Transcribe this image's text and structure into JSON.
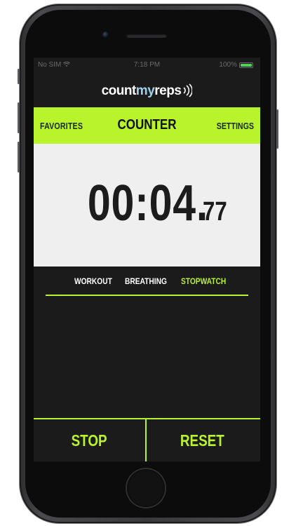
{
  "status_bar": {
    "carrier": "No SIM",
    "wifi_icon": "wifi-icon",
    "time": "7:18 PM",
    "battery_percent": "100%",
    "battery_level": 1.0,
    "battery_color": "#4bd15c"
  },
  "logo": {
    "part1": "count",
    "part2": "my",
    "part3": "reps",
    "icon": "sound-waves-icon"
  },
  "nav": {
    "left": "FAVORITES",
    "title": "COUNTER",
    "right": "SETTINGS"
  },
  "timer": {
    "main": "00:04.",
    "fraction": "77"
  },
  "modes": {
    "items": [
      "WORKOUT",
      "BREATHING",
      "STOPWATCH"
    ],
    "active": "STOPWATCH"
  },
  "controls": {
    "stop_label": "STOP",
    "reset_label": "RESET"
  },
  "colors": {
    "accent": "#b9f32b",
    "background": "#1b1b1b",
    "timer_panel": "#efefef"
  }
}
